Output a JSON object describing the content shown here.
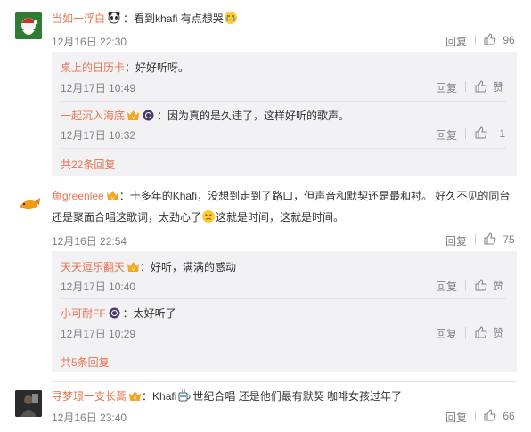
{
  "comments": [
    {
      "user": "当如一浮白",
      "text": "：看到khafi 有点想哭",
      "time": "12月16日 22:30",
      "reply_label": "回复",
      "likes": "96",
      "replies": [
        {
          "user": "桌上的日历卡",
          "text": "：好好听呀。",
          "time": "12月17日 10:49",
          "reply_label": "回复",
          "likes": "赞"
        },
        {
          "user": "一起沉入海底",
          "text": "：因为真的是久违了，这样好听的歌声。",
          "time": "12月17日 10:32",
          "reply_label": "回复",
          "likes": "1"
        }
      ],
      "more": "共22条回复"
    },
    {
      "user": "鱼greenlee",
      "text_line1": "：十多年的Khafi，没想到走到了路口，但声音和默契还是最和衬。 好久不见的同台",
      "text_line2a": "还是聚面合唱这歌词，太劲心了",
      "text_line2b": "这就是时间，这就是时间。",
      "time": "12月16日 22:54",
      "reply_label": "回复",
      "likes": "75",
      "replies": [
        {
          "user": "天天逗乐翻天",
          "text": "：好听，满满的感动",
          "time": "12月17日 10:40",
          "reply_label": "回复",
          "likes": "赞"
        },
        {
          "user": "小可耐FF",
          "text": "：太好听了",
          "time": "12月17日 10:29",
          "reply_label": "回复",
          "likes": "赞"
        }
      ],
      "more": "共5条回复"
    },
    {
      "user": "寻梦璟一支长蒿",
      "text_a": "：Khafi",
      "text_b": "世纪合唱 还是他们最有默契  咖啡女孩过年了",
      "time": "12月16日 23:40",
      "reply_label": "回复",
      "likes": "66"
    }
  ],
  "colors": {
    "name": "#eb7350",
    "text": "#333333",
    "meta": "#808080",
    "reply_bg": "#f2f2f5"
  }
}
